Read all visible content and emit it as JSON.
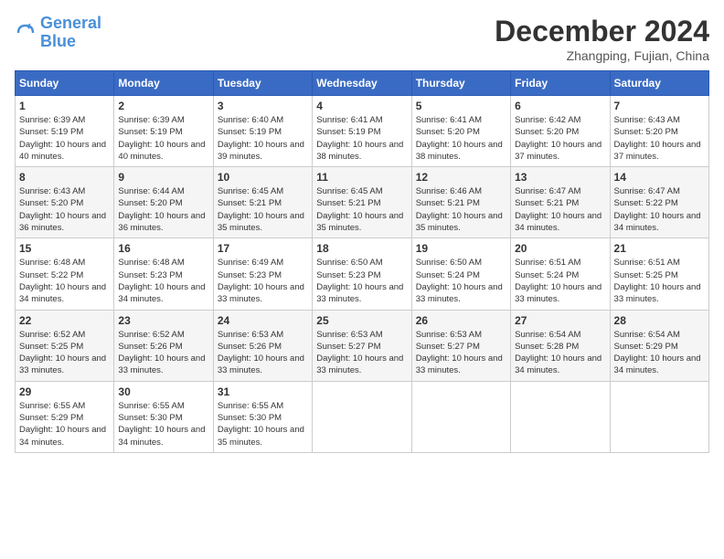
{
  "logo": {
    "line1": "General",
    "line2": "Blue"
  },
  "title": "December 2024",
  "location": "Zhangping, Fujian, China",
  "weekdays": [
    "Sunday",
    "Monday",
    "Tuesday",
    "Wednesday",
    "Thursday",
    "Friday",
    "Saturday"
  ],
  "weeks": [
    [
      {
        "day": "1",
        "sunrise": "6:39 AM",
        "sunset": "5:19 PM",
        "daylight": "10 hours and 40 minutes."
      },
      {
        "day": "2",
        "sunrise": "6:39 AM",
        "sunset": "5:19 PM",
        "daylight": "10 hours and 40 minutes."
      },
      {
        "day": "3",
        "sunrise": "6:40 AM",
        "sunset": "5:19 PM",
        "daylight": "10 hours and 39 minutes."
      },
      {
        "day": "4",
        "sunrise": "6:41 AM",
        "sunset": "5:19 PM",
        "daylight": "10 hours and 38 minutes."
      },
      {
        "day": "5",
        "sunrise": "6:41 AM",
        "sunset": "5:20 PM",
        "daylight": "10 hours and 38 minutes."
      },
      {
        "day": "6",
        "sunrise": "6:42 AM",
        "sunset": "5:20 PM",
        "daylight": "10 hours and 37 minutes."
      },
      {
        "day": "7",
        "sunrise": "6:43 AM",
        "sunset": "5:20 PM",
        "daylight": "10 hours and 37 minutes."
      }
    ],
    [
      {
        "day": "8",
        "sunrise": "6:43 AM",
        "sunset": "5:20 PM",
        "daylight": "10 hours and 36 minutes."
      },
      {
        "day": "9",
        "sunrise": "6:44 AM",
        "sunset": "5:20 PM",
        "daylight": "10 hours and 36 minutes."
      },
      {
        "day": "10",
        "sunrise": "6:45 AM",
        "sunset": "5:21 PM",
        "daylight": "10 hours and 35 minutes."
      },
      {
        "day": "11",
        "sunrise": "6:45 AM",
        "sunset": "5:21 PM",
        "daylight": "10 hours and 35 minutes."
      },
      {
        "day": "12",
        "sunrise": "6:46 AM",
        "sunset": "5:21 PM",
        "daylight": "10 hours and 35 minutes."
      },
      {
        "day": "13",
        "sunrise": "6:47 AM",
        "sunset": "5:21 PM",
        "daylight": "10 hours and 34 minutes."
      },
      {
        "day": "14",
        "sunrise": "6:47 AM",
        "sunset": "5:22 PM",
        "daylight": "10 hours and 34 minutes."
      }
    ],
    [
      {
        "day": "15",
        "sunrise": "6:48 AM",
        "sunset": "5:22 PM",
        "daylight": "10 hours and 34 minutes."
      },
      {
        "day": "16",
        "sunrise": "6:48 AM",
        "sunset": "5:23 PM",
        "daylight": "10 hours and 34 minutes."
      },
      {
        "day": "17",
        "sunrise": "6:49 AM",
        "sunset": "5:23 PM",
        "daylight": "10 hours and 33 minutes."
      },
      {
        "day": "18",
        "sunrise": "6:50 AM",
        "sunset": "5:23 PM",
        "daylight": "10 hours and 33 minutes."
      },
      {
        "day": "19",
        "sunrise": "6:50 AM",
        "sunset": "5:24 PM",
        "daylight": "10 hours and 33 minutes."
      },
      {
        "day": "20",
        "sunrise": "6:51 AM",
        "sunset": "5:24 PM",
        "daylight": "10 hours and 33 minutes."
      },
      {
        "day": "21",
        "sunrise": "6:51 AM",
        "sunset": "5:25 PM",
        "daylight": "10 hours and 33 minutes."
      }
    ],
    [
      {
        "day": "22",
        "sunrise": "6:52 AM",
        "sunset": "5:25 PM",
        "daylight": "10 hours and 33 minutes."
      },
      {
        "day": "23",
        "sunrise": "6:52 AM",
        "sunset": "5:26 PM",
        "daylight": "10 hours and 33 minutes."
      },
      {
        "day": "24",
        "sunrise": "6:53 AM",
        "sunset": "5:26 PM",
        "daylight": "10 hours and 33 minutes."
      },
      {
        "day": "25",
        "sunrise": "6:53 AM",
        "sunset": "5:27 PM",
        "daylight": "10 hours and 33 minutes."
      },
      {
        "day": "26",
        "sunrise": "6:53 AM",
        "sunset": "5:27 PM",
        "daylight": "10 hours and 33 minutes."
      },
      {
        "day": "27",
        "sunrise": "6:54 AM",
        "sunset": "5:28 PM",
        "daylight": "10 hours and 34 minutes."
      },
      {
        "day": "28",
        "sunrise": "6:54 AM",
        "sunset": "5:29 PM",
        "daylight": "10 hours and 34 minutes."
      }
    ],
    [
      {
        "day": "29",
        "sunrise": "6:55 AM",
        "sunset": "5:29 PM",
        "daylight": "10 hours and 34 minutes."
      },
      {
        "day": "30",
        "sunrise": "6:55 AM",
        "sunset": "5:30 PM",
        "daylight": "10 hours and 34 minutes."
      },
      {
        "day": "31",
        "sunrise": "6:55 AM",
        "sunset": "5:30 PM",
        "daylight": "10 hours and 35 minutes."
      },
      null,
      null,
      null,
      null
    ]
  ]
}
